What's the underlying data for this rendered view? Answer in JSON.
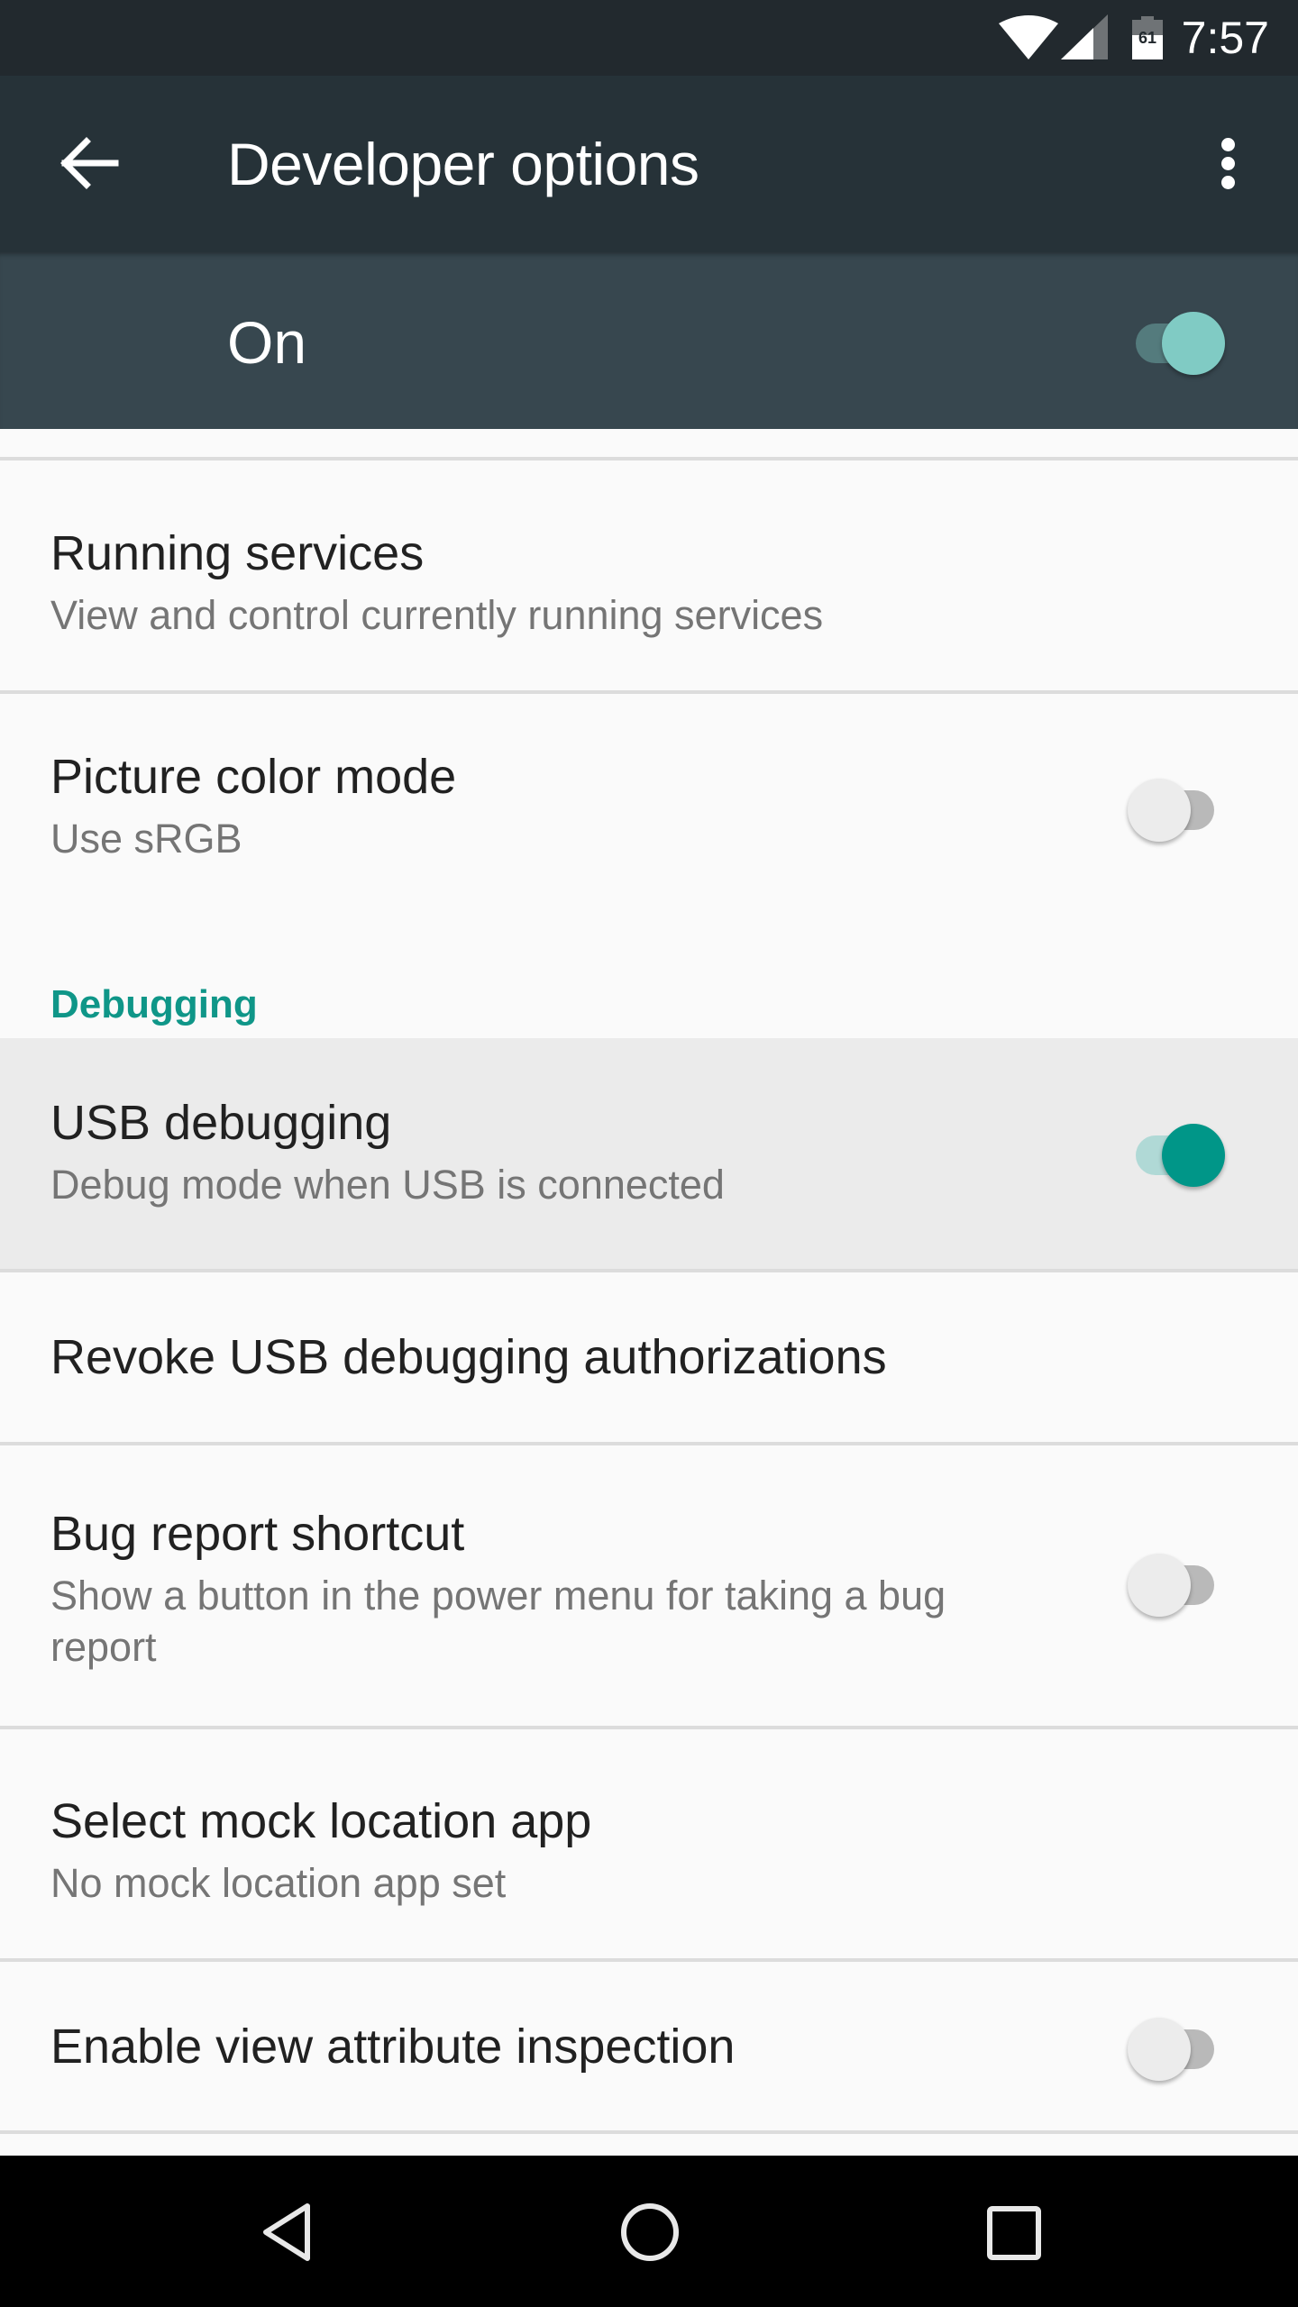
{
  "status_bar": {
    "time": "7:57",
    "battery_level": "61",
    "icons": [
      "wifi-icon",
      "cell-signal-icon",
      "battery-icon"
    ]
  },
  "toolbar": {
    "back_icon": "arrow-back-icon",
    "title": "Developer options",
    "overflow_icon": "more-vert-icon"
  },
  "master_switch": {
    "label": "On",
    "checked": true
  },
  "list": {
    "items": [
      {
        "title": "Running services",
        "summary": "View and control currently running services"
      },
      {
        "title": "Picture color mode",
        "summary": "Use sRGB",
        "switch": false
      },
      {
        "title": "USB debugging",
        "summary": "Debug mode when USB is connected",
        "switch": true
      },
      {
        "title": "Revoke USB debugging authorizations"
      },
      {
        "title": "Bug report shortcut",
        "summary": "Show a button in the power menu for taking a bug report",
        "switch": false
      },
      {
        "title": "Select mock location app",
        "summary": "No mock location app set"
      },
      {
        "title": "Enable view attribute inspection",
        "switch": false
      }
    ],
    "sections": {
      "debugging": "Debugging"
    }
  },
  "colors": {
    "status_bar": "#22292e",
    "toolbar": "#263238",
    "master_bar": "#37474f",
    "accent": "#009688",
    "background": "#fafafa",
    "highlight": "#ebebeb"
  },
  "nav_bar": {
    "buttons": [
      "back-triangle-icon",
      "home-circle-icon",
      "recents-square-icon"
    ]
  }
}
